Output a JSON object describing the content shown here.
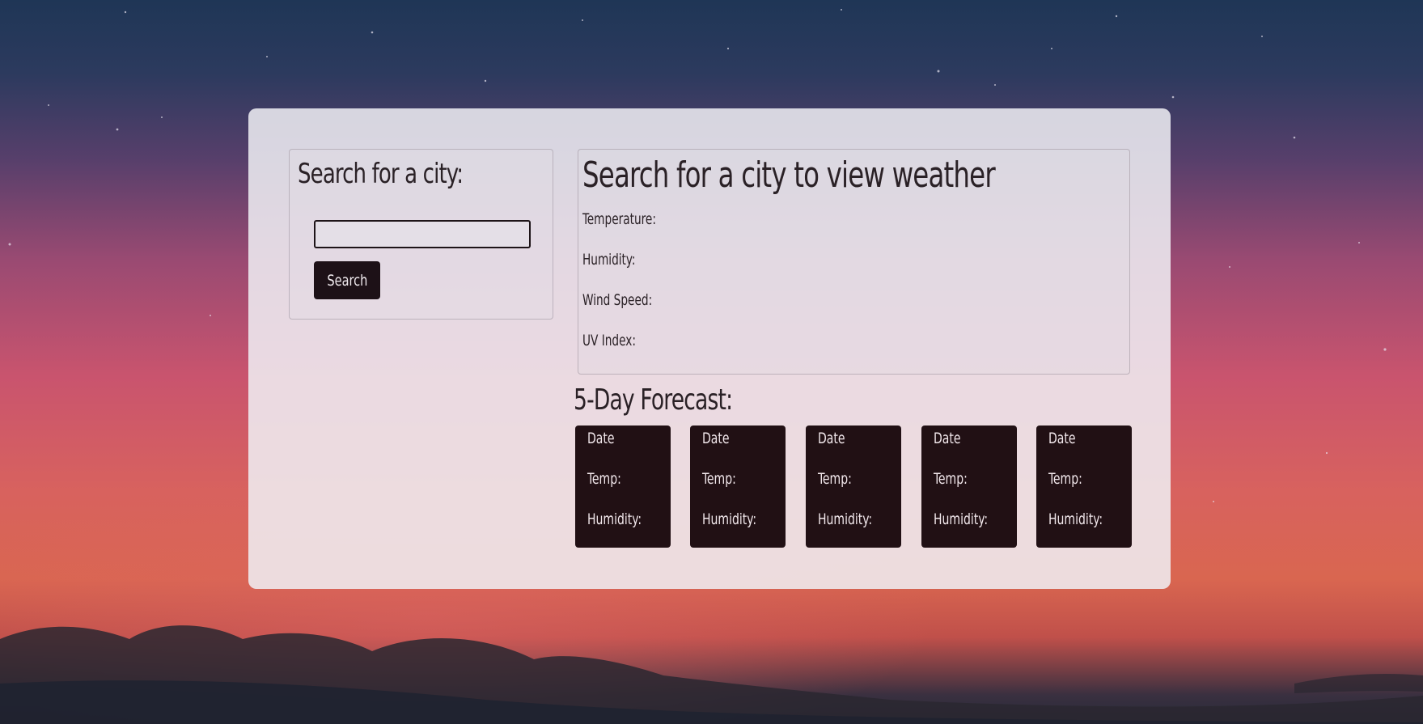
{
  "search": {
    "heading": "Search for a city:",
    "input_value": "",
    "input_placeholder": "",
    "button_label": "Search"
  },
  "current": {
    "heading": "Search for a city to view weather",
    "temperature_label": "Temperature:",
    "humidity_label": "Humidity:",
    "wind_label": "Wind Speed:",
    "uv_label": "UV Index:"
  },
  "forecast": {
    "heading": "5-Day Forecast:",
    "days": [
      {
        "date": "Date",
        "temp": "Temp:",
        "humidity": "Humidity:"
      },
      {
        "date": "Date",
        "temp": "Temp:",
        "humidity": "Humidity:"
      },
      {
        "date": "Date",
        "temp": "Temp:",
        "humidity": "Humidity:"
      },
      {
        "date": "Date",
        "temp": "Temp:",
        "humidity": "Humidity:"
      },
      {
        "date": "Date",
        "temp": "Temp:",
        "humidity": "Humidity:"
      }
    ]
  },
  "colors": {
    "panel": "#f0f0f4",
    "button": "#1d1117",
    "forecast_card": "#211014",
    "text_dark": "#2a2126",
    "text_light": "#f2e8ec"
  }
}
